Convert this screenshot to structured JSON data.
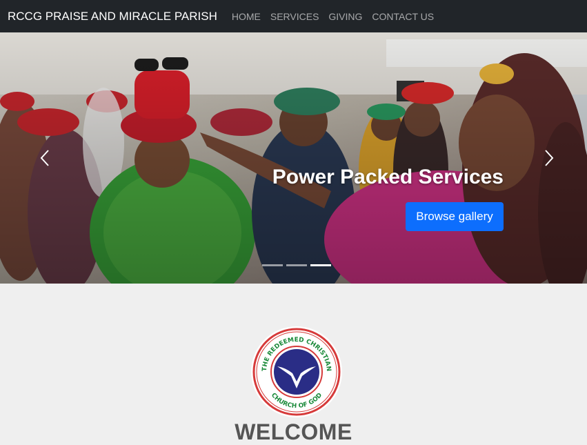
{
  "navbar": {
    "brand": "RCCG PRAISE AND MIRACLE PARISH",
    "links": [
      {
        "label": "HOME"
      },
      {
        "label": "SERVICES"
      },
      {
        "label": "GIVING"
      },
      {
        "label": "CONTACT US"
      }
    ]
  },
  "carousel": {
    "caption_title": "Power Packed Services",
    "button_label": "Browse gallery",
    "slide_count": 3,
    "active_slide": 3,
    "controls": {
      "prev_icon": "chevron-left-icon",
      "next_icon": "chevron-right-icon"
    }
  },
  "logo": {
    "text_top": "THE REDEEMED CHRISTIAN",
    "text_bottom": "CHURCH OF GOD"
  },
  "welcome": {
    "title": "WELCOME"
  },
  "colors": {
    "navbar_bg": "#212529",
    "button_blue": "#0d6efd",
    "page_bg": "#efefef",
    "logo_navy": "#2a2d86",
    "logo_green": "#1a8a3a",
    "logo_red": "#d63a3a"
  }
}
